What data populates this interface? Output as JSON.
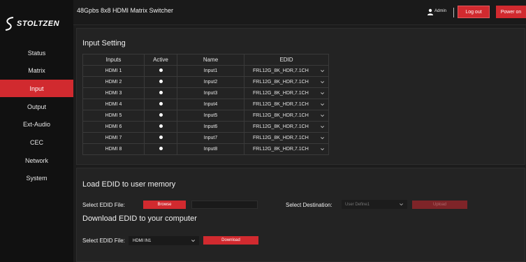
{
  "brand": {
    "logo_text": "STOLTZEN"
  },
  "header": {
    "title": "48Gpbs 8x8 HDMI Matrix Switcher",
    "user_name": "Admin",
    "logout_label": "Log out",
    "power_label": "Power on"
  },
  "sidebar": {
    "items": [
      {
        "label": "Status"
      },
      {
        "label": "Matrix"
      },
      {
        "label": "Input"
      },
      {
        "label": "Output"
      },
      {
        "label": "Ext-Audio"
      },
      {
        "label": "CEC"
      },
      {
        "label": "Network"
      },
      {
        "label": "System"
      }
    ],
    "active_item": "Input"
  },
  "input_setting": {
    "title": "Input Setting",
    "columns": [
      "Inputs",
      "Active",
      "Name",
      "EDID"
    ],
    "rows": [
      {
        "input": "HDMI 1",
        "active": true,
        "name": "Input1",
        "edid": "FRL12G_8K_HDR,7.1CH"
      },
      {
        "input": "HDMI 2",
        "active": true,
        "name": "Input2",
        "edid": "FRL12G_8K_HDR,7.1CH"
      },
      {
        "input": "HDMI 3",
        "active": true,
        "name": "Input3",
        "edid": "FRL12G_8K_HDR,7.1CH"
      },
      {
        "input": "HDMI 4",
        "active": true,
        "name": "Input4",
        "edid": "FRL12G_8K_HDR,7.1CH"
      },
      {
        "input": "HDMI 5",
        "active": true,
        "name": "Input5",
        "edid": "FRL12G_8K_HDR,7.1CH"
      },
      {
        "input": "HDMI 6",
        "active": true,
        "name": "Input6",
        "edid": "FRL12G_8K_HDR,7.1CH"
      },
      {
        "input": "HDMI 7",
        "active": true,
        "name": "Input7",
        "edid": "FRL12G_8K_HDR,7.1CH"
      },
      {
        "input": "HDMI 8",
        "active": true,
        "name": "Input8",
        "edid": "FRL12G_8K_HDR,7.1CH"
      }
    ]
  },
  "edid": {
    "load_title": "Load EDID to user memory",
    "select_file_label": "Select EDID File:",
    "browse_label": "Browse",
    "file_value": "",
    "destination_label": "Select Destination:",
    "destination_value": "User Define1",
    "upload_label": "Upload",
    "download_title": "Download EDID to your computer",
    "download_select_label": "Select EDID File:",
    "download_file_value": "HDMI IN1",
    "download_label": "Download"
  },
  "colors": {
    "accent": "#d12a2f",
    "sidebar_bg": "#111111",
    "panel_bg": "#232323",
    "page_bg": "#1c1c1c"
  },
  "icons": {
    "user": "user-icon",
    "chevron": "chevron-down-icon",
    "logo": "stoltzen-logo-icon"
  }
}
